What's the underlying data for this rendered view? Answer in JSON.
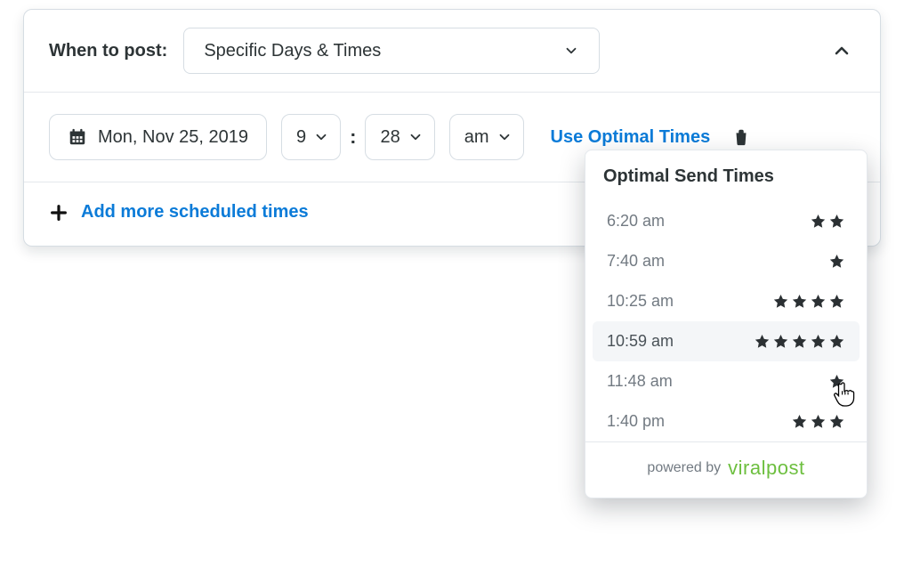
{
  "header": {
    "label": "When to post:",
    "schedule_mode": "Specific Days & Times"
  },
  "row": {
    "date": "Mon, Nov 25, 2019",
    "hour": "9",
    "minute": "28",
    "ampm": "am",
    "optimal_link": "Use Optimal Times"
  },
  "footer": {
    "add_more": "Add more scheduled times"
  },
  "popover": {
    "title": "Optimal Send Times",
    "items": [
      {
        "time": "6:20 am",
        "stars": 2,
        "highlight": false
      },
      {
        "time": "7:40 am",
        "stars": 1,
        "highlight": false
      },
      {
        "time": "10:25 am",
        "stars": 4,
        "highlight": false
      },
      {
        "time": "10:59 am",
        "stars": 5,
        "highlight": true
      },
      {
        "time": "11:48 am",
        "stars": 1,
        "highlight": false
      },
      {
        "time": "1:40 pm",
        "stars": 3,
        "highlight": false
      }
    ],
    "powered_by": "powered by",
    "brand": "viralpost"
  }
}
